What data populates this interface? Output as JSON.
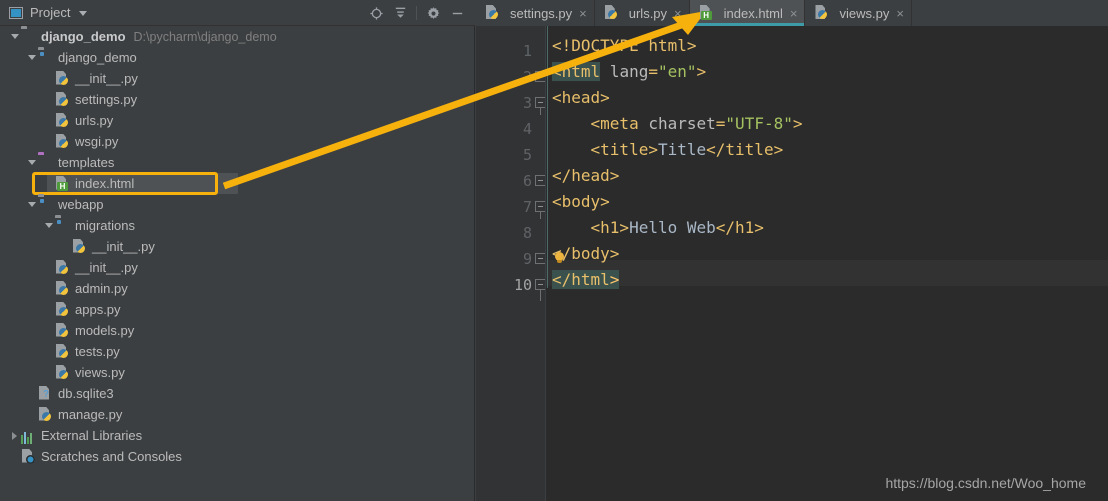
{
  "window": {
    "tool_window_title": "Project",
    "watermark": "https://blog.csdn.net/Woo_home"
  },
  "colors": {
    "annotation": "#f6b10d",
    "active_tab_underline": "#3d9ca8",
    "editor_bg": "#2b2b2b",
    "panel_bg": "#3c3f41",
    "gutter_bg": "#313335",
    "selection_bg": "#4e5254",
    "tag_color": "#e8bf6a",
    "attr_value_color": "#a5c261",
    "brace_match_bg": "#3b514d"
  },
  "toolbar": {
    "buttons": [
      {
        "name": "locate-file-icon",
        "tooltip": "Select Opened File"
      },
      {
        "name": "collapse-all-icon",
        "tooltip": "Collapse All"
      },
      {
        "name": "gear-icon",
        "tooltip": "Settings"
      },
      {
        "name": "minimize-icon",
        "tooltip": "Hide"
      }
    ]
  },
  "tree": [
    {
      "label": "django_demo",
      "path": "D:\\pycharm\\django_demo",
      "icon": "folder-root",
      "twisty": "open",
      "indent": 0,
      "bold": true,
      "selected": false
    },
    {
      "label": "django_demo",
      "path": "",
      "icon": "folder-module",
      "twisty": "open",
      "indent": 1,
      "bold": false,
      "selected": false
    },
    {
      "label": "__init__.py",
      "path": "",
      "icon": "python-file",
      "twisty": "none",
      "indent": 2,
      "bold": false,
      "selected": false
    },
    {
      "label": "settings.py",
      "path": "",
      "icon": "python-file",
      "twisty": "none",
      "indent": 2,
      "bold": false,
      "selected": false
    },
    {
      "label": "urls.py",
      "path": "",
      "icon": "python-file",
      "twisty": "none",
      "indent": 2,
      "bold": false,
      "selected": false
    },
    {
      "label": "wsgi.py",
      "path": "",
      "icon": "python-file",
      "twisty": "none",
      "indent": 2,
      "bold": false,
      "selected": false
    },
    {
      "label": "templates",
      "path": "",
      "icon": "folder-templates",
      "twisty": "open",
      "indent": 1,
      "bold": false,
      "selected": false
    },
    {
      "label": "index.html",
      "path": "",
      "icon": "html-file",
      "twisty": "none",
      "indent": 2,
      "bold": false,
      "selected": true
    },
    {
      "label": "webapp",
      "path": "",
      "icon": "folder-module",
      "twisty": "open",
      "indent": 1,
      "bold": false,
      "selected": false
    },
    {
      "label": "migrations",
      "path": "",
      "icon": "folder-module",
      "twisty": "open",
      "indent": 2,
      "bold": false,
      "selected": false
    },
    {
      "label": "__init__.py",
      "path": "",
      "icon": "python-file",
      "twisty": "none",
      "indent": 3,
      "bold": false,
      "selected": false
    },
    {
      "label": "__init__.py",
      "path": "",
      "icon": "python-file",
      "twisty": "none",
      "indent": 2,
      "bold": false,
      "selected": false
    },
    {
      "label": "admin.py",
      "path": "",
      "icon": "python-file",
      "twisty": "none",
      "indent": 2,
      "bold": false,
      "selected": false
    },
    {
      "label": "apps.py",
      "path": "",
      "icon": "python-file",
      "twisty": "none",
      "indent": 2,
      "bold": false,
      "selected": false
    },
    {
      "label": "models.py",
      "path": "",
      "icon": "python-file",
      "twisty": "none",
      "indent": 2,
      "bold": false,
      "selected": false
    },
    {
      "label": "tests.py",
      "path": "",
      "icon": "python-file",
      "twisty": "none",
      "indent": 2,
      "bold": false,
      "selected": false
    },
    {
      "label": "views.py",
      "path": "",
      "icon": "python-file",
      "twisty": "none",
      "indent": 2,
      "bold": false,
      "selected": false
    },
    {
      "label": "db.sqlite3",
      "path": "",
      "icon": "db-file",
      "twisty": "none",
      "indent": 1,
      "bold": false,
      "selected": false
    },
    {
      "label": "manage.py",
      "path": "",
      "icon": "python-file",
      "twisty": "none",
      "indent": 1,
      "bold": false,
      "selected": false
    },
    {
      "label": "External Libraries",
      "path": "",
      "icon": "library-icon",
      "twisty": "closed",
      "indent": 0,
      "bold": false,
      "selected": false
    },
    {
      "label": "Scratches and Consoles",
      "path": "",
      "icon": "scratch-icon",
      "twisty": "none",
      "indent": 0,
      "bold": false,
      "selected": false
    }
  ],
  "editor_tabs": [
    {
      "label": "settings.py",
      "icon": "python-file",
      "active": false,
      "close": "×"
    },
    {
      "label": "urls.py",
      "icon": "python-file",
      "active": false,
      "close": "×"
    },
    {
      "label": "index.html",
      "icon": "html-file",
      "active": true,
      "close": "×"
    },
    {
      "label": "views.py",
      "icon": "python-file",
      "active": false,
      "close": "×"
    }
  ],
  "editor": {
    "line_numbers": [
      "1",
      "2",
      "3",
      "4",
      "5",
      "6",
      "7",
      "8",
      "9",
      "10"
    ],
    "current_line": 10,
    "lines": [
      {
        "n": 1,
        "text": "<!DOCTYPE html>"
      },
      {
        "n": 2,
        "text": "<html lang=\"en\">"
      },
      {
        "n": 3,
        "text": "<head>"
      },
      {
        "n": 4,
        "text": "    <meta charset=\"UTF-8\">"
      },
      {
        "n": 5,
        "text": "    <title>Title</title>"
      },
      {
        "n": 6,
        "text": "</head>"
      },
      {
        "n": 7,
        "text": "<body>"
      },
      {
        "n": 8,
        "text": "    <h1>Hello Web</h1>"
      },
      {
        "n": 9,
        "text": "</body>"
      },
      {
        "n": 10,
        "text": "</html>"
      }
    ]
  },
  "annotation": {
    "highlight_target": "index.html",
    "arrow_from": "tree index.html row",
    "arrow_to": "index.html editor tab"
  }
}
